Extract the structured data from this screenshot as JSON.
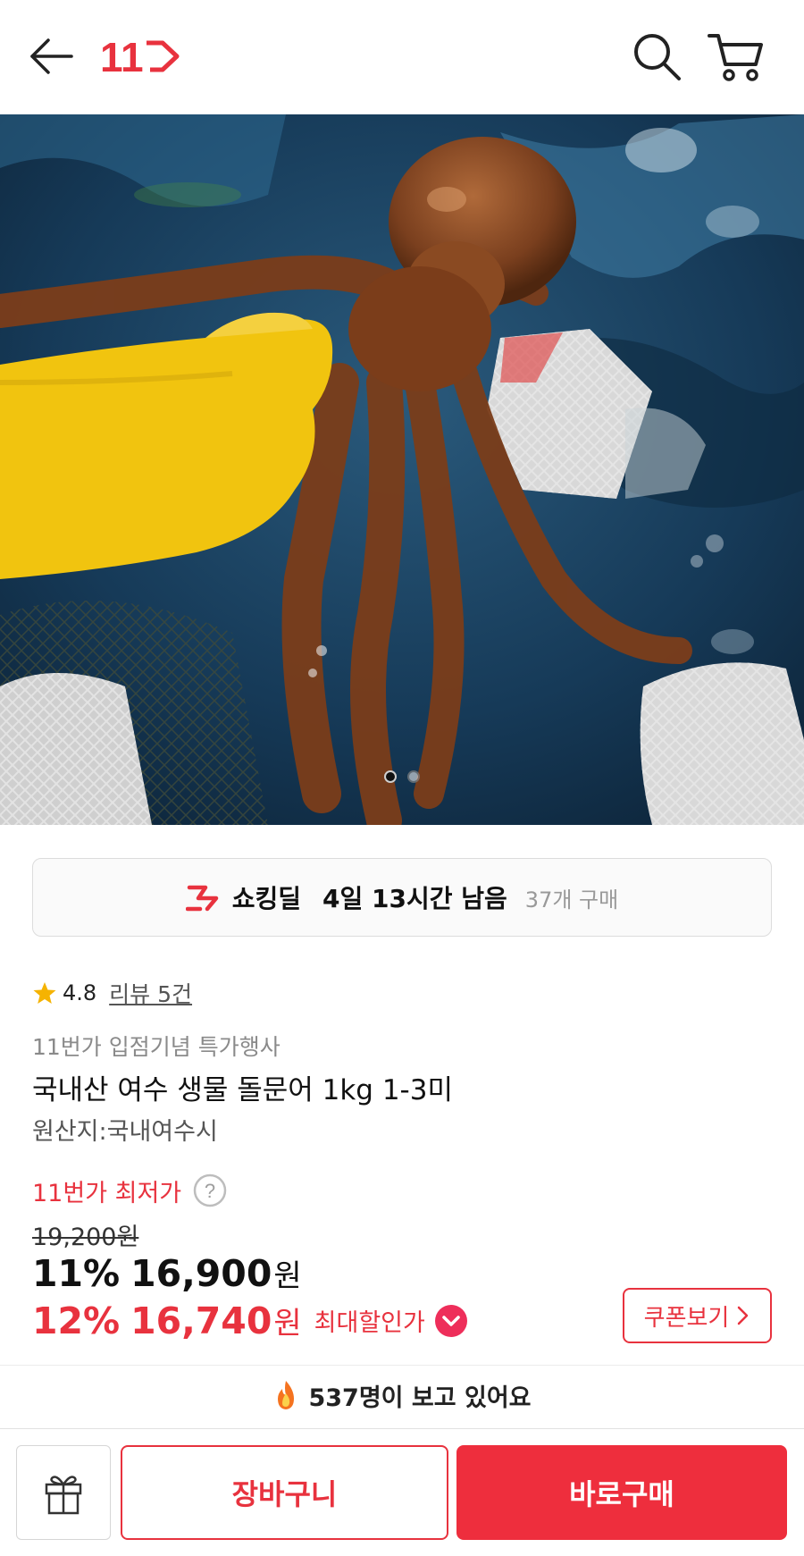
{
  "header": {
    "logo_text": "11",
    "back_icon": "arrow-left-icon",
    "search_icon": "search-icon",
    "cart_icon": "cart-icon",
    "brand_color": "#e8323e"
  },
  "product_image": {
    "alt": "국내산 여수 생물 돌문어 1kg 1-3미",
    "slide_count": 2,
    "active_slide": 1
  },
  "deal": {
    "icon": "shocking-deal-icon",
    "title": "쇼킹딜",
    "time_left": "4일 13시간 남음",
    "purchase_count": "37개 구매"
  },
  "rating": {
    "value": "4.8",
    "review_link": "리뷰 5건"
  },
  "product": {
    "promo": "11번가 입점기념 특가행사",
    "title": "국내산 여수 생물 돌문어 1kg 1-3미",
    "origin": "원산지:국내여수시"
  },
  "pricing": {
    "lowest_label": "11번가 최저가",
    "original_price": "19,200원",
    "discount_rate": "11%",
    "sale_price": "16,900",
    "currency": "원",
    "max_discount_rate": "12%",
    "max_price": "16,740",
    "max_label": "최대할인가",
    "coupon_button": "쿠폰보기"
  },
  "viewers": {
    "text": "537명이 보고 있어요"
  },
  "bottom_bar": {
    "gift_icon": "gift-icon",
    "cart_button": "장바구니",
    "buy_button": "바로구매",
    "buy_color": "#ee2e3d"
  }
}
